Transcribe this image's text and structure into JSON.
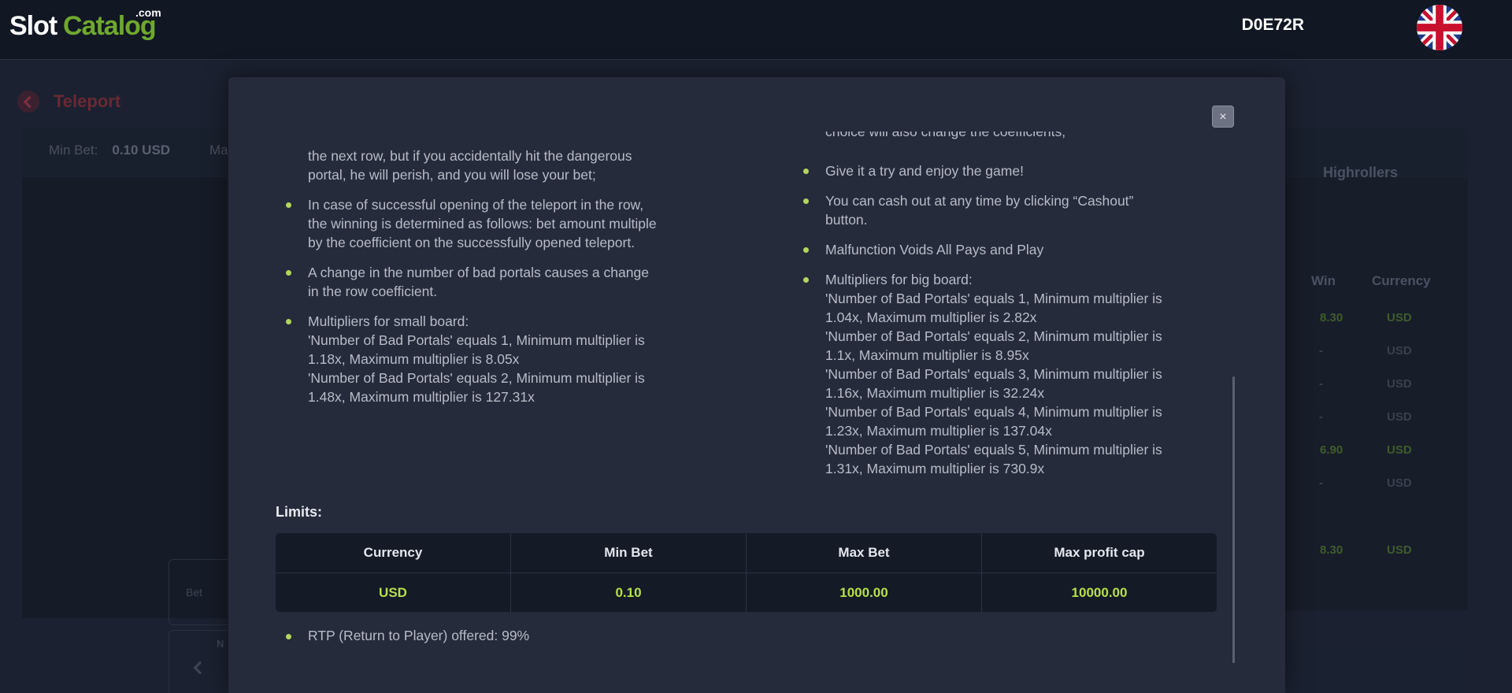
{
  "header": {
    "logo": {
      "slot": "Slot",
      "catalog": "Catalog",
      "com": ".com"
    },
    "user_id": "D0E72R",
    "language_icon": "uk-flag-icon"
  },
  "background": {
    "game_title": "Teleport",
    "min_bet_label": "Min Bet:",
    "min_bet_value": "0.10 USD",
    "max_bet_label_partial": "Ma",
    "tab_label": "Highrollers",
    "table_headers": {
      "win": "Win",
      "currency": "Currency"
    },
    "rows": [
      {
        "win": "8.30",
        "currency": "USD"
      },
      {
        "win": "-",
        "currency": "USD"
      },
      {
        "win": "-",
        "currency": "USD"
      },
      {
        "win": "-",
        "currency": "USD"
      },
      {
        "win": "6.90",
        "currency": "USD"
      },
      {
        "win": "-",
        "currency": "USD"
      },
      {
        "win": "8.30",
        "currency": "USD"
      }
    ],
    "bet_label": "Bet",
    "nav_label_partial": "N"
  },
  "modal": {
    "left_items": [
      {
        "lines": [
          "the next row, but if you accidentally hit the dangerous",
          "portal, he will perish, and you will lose your bet;"
        ],
        "bullet": false
      },
      {
        "lines": [
          "In case of successful opening of the teleport in the row,",
          "the winning is determined as follows: bet amount multiple",
          "by the coefficient on the successfully opened teleport."
        ],
        "bullet": true
      },
      {
        "lines": [
          "A change in the number of bad portals causes a change",
          "in the row coefficient."
        ],
        "bullet": true
      },
      {
        "lines": [
          "Multipliers for small board:",
          "'Number of Bad Portals' equals 1, Minimum multiplier is",
          "1.18x, Maximum multiplier is 8.05x",
          "'Number of Bad Portals' equals 2, Minimum multiplier is",
          "1.48x, Maximum multiplier is 127.31x"
        ],
        "bullet": true
      }
    ],
    "right_partial": "choice will also change the coefficients;",
    "right_items": [
      {
        "lines": [
          "Give it a try and enjoy the game!"
        ]
      },
      {
        "lines": [
          "You can cash out at any time by clicking “Cashout”",
          "button."
        ]
      },
      {
        "lines": [
          "Malfunction Voids All Pays and Play"
        ]
      },
      {
        "lines": [
          "Multipliers for big board:",
          "'Number of Bad Portals' equals 1, Minimum multiplier is",
          "1.04x, Maximum multiplier is 2.82x",
          "'Number of Bad Portals' equals 2, Minimum multiplier is",
          "1.1x, Maximum multiplier is 8.95x",
          "'Number of Bad Portals' equals 3, Minimum multiplier is",
          "1.16x, Maximum multiplier is 32.24x",
          "'Number of Bad Portals' equals 4, Minimum multiplier is",
          "1.23x, Maximum multiplier is 137.04x",
          "'Number of Bad Portals' equals 5, Minimum multiplier is",
          "1.31x, Maximum multiplier is 730.9x"
        ]
      }
    ],
    "limits_title": "Limits:",
    "limits_table": {
      "headers": [
        "Currency",
        "Min Bet",
        "Max Bet",
        "Max profit cap"
      ],
      "values": [
        "USD",
        "0.10",
        "1000.00",
        "10000.00"
      ]
    },
    "rtp": "RTP (Return to Player) offered: 99%",
    "close_label": "×"
  },
  "colors": {
    "accent_green": "#b5e04a",
    "bullet": "#b3d65a",
    "modal_bg": "#252b3a",
    "page_bg": "#1b2130"
  }
}
